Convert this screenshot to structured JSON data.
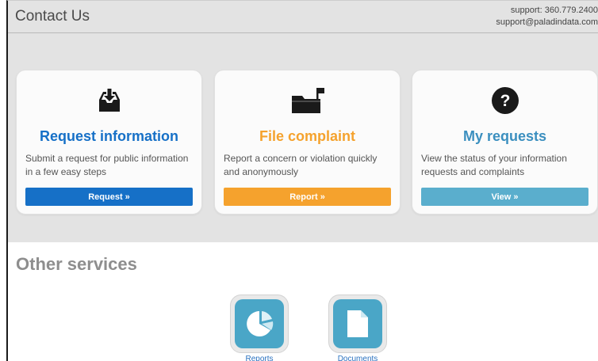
{
  "header": {
    "title": "Contact Us",
    "support_phone": "support: 360.779.2400",
    "support_email": "support@paladindata.com"
  },
  "cards": [
    {
      "icon": "inbox-download-icon",
      "title": "Request information",
      "description": "Submit a request for public information in a few easy steps",
      "button": "Request »",
      "color": "#1670c7"
    },
    {
      "icon": "folder-flag-icon",
      "title": "File complaint",
      "description": "Report a concern or violation quickly and anonymously",
      "button": "Report »",
      "color": "#f5a22d"
    },
    {
      "icon": "question-circle-icon",
      "title": "My requests",
      "description": "View the status of your information requests and complaints",
      "button": "View »",
      "color": "#5aaecd",
      "title_color": "#3b8fbf"
    }
  ],
  "other_services": {
    "title": "Other services",
    "items": [
      {
        "label": "Reports",
        "icon": "pie-chart-icon",
        "color": "#4aa6c7"
      },
      {
        "label": "Documents",
        "icon": "document-icon",
        "color": "#4aa6c7"
      }
    ]
  }
}
